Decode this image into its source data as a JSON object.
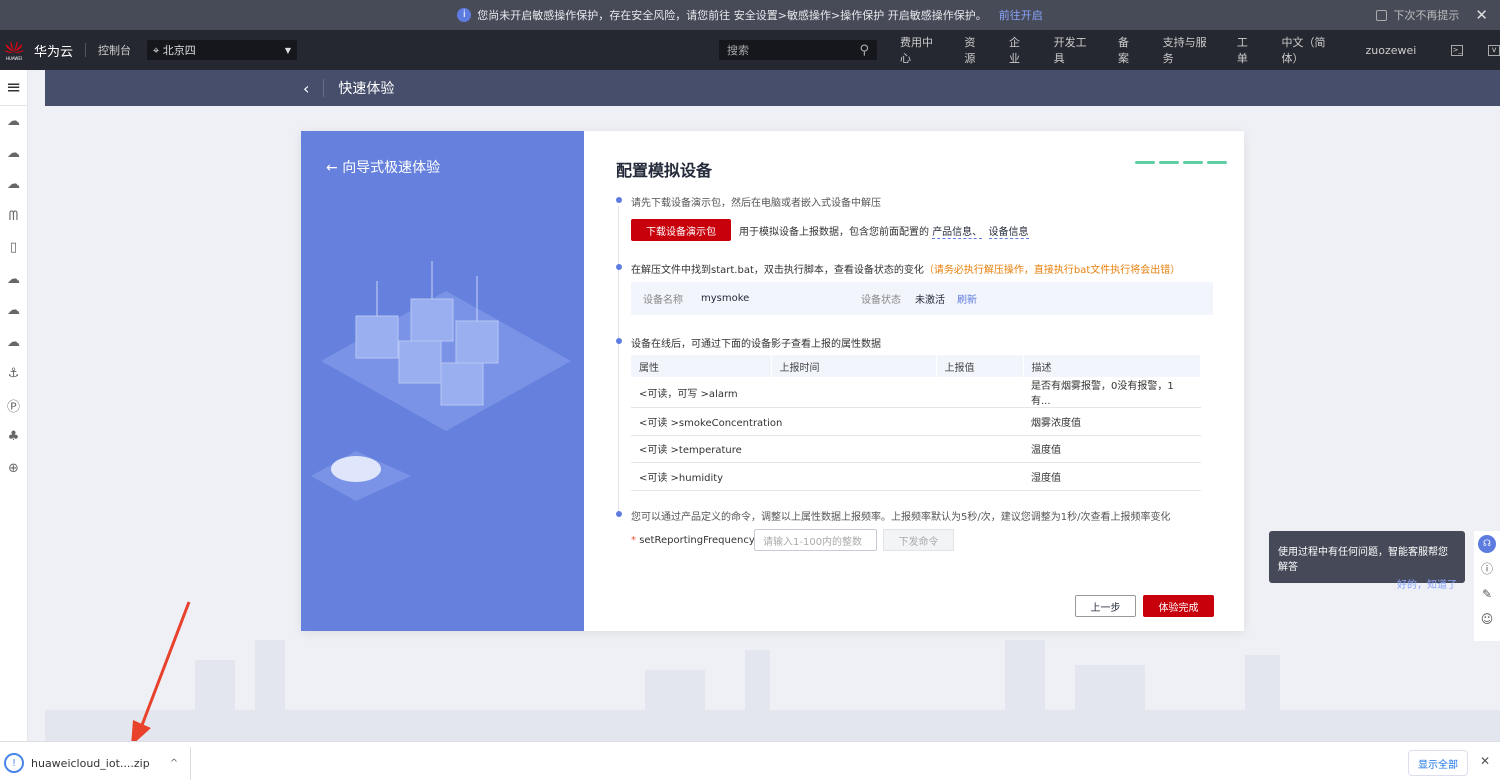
{
  "banner": {
    "message": "您尚未开启敏感操作保护，存在安全风险，请您前往 安全设置>敏感操作>操作保护 开启敏感操作保护。",
    "link": "前往开启",
    "dont_show": "下次不再提示"
  },
  "nav": {
    "logo_text": "HUAWEI",
    "brand": "华为云",
    "console": "控制台",
    "region": "北京四",
    "search_placeholder": "搜索",
    "items": [
      "费用中心",
      "资源",
      "企业",
      "开发工具",
      "备案",
      "支持与服务",
      "工单",
      "中文（简体）",
      "zuozewei"
    ]
  },
  "subheader": {
    "title": "快速体验"
  },
  "left_panel": {
    "title": "向导式极速体验"
  },
  "main": {
    "title": "配置模拟设备",
    "steps_total": 4,
    "steps_completed": 4,
    "accent": "#5cd0a1",
    "step1": {
      "text": "请先下载设备演示包，然后在电脑或者嵌入式设备中解压",
      "button": "下载设备演示包",
      "desc": "用于模拟设备上报数据，包含您前面配置的",
      "link1": "产品信息、",
      "link2": "设备信息"
    },
    "step2": {
      "text": "在解压文件中找到start.bat，双击执行脚本，查看设备状态的变化",
      "warning": "（请务必执行解压操作，直接执行bat文件执行将会出错）",
      "device_name_label": "设备名称",
      "device_name": "mysmoke",
      "device_status_label": "设备状态",
      "device_status": "未激活",
      "refresh": "刷新"
    },
    "step3": {
      "text": "设备在线后，可通过下面的设备影子查看上报的属性数据",
      "columns": [
        "属性",
        "上报时间",
        "上报值",
        "描述"
      ],
      "rows": [
        [
          "<可读，可写 >alarm",
          "",
          "",
          "是否有烟雾报警，0没有报警，1有..."
        ],
        [
          "<可读 >smokeConcentration",
          "",
          "",
          "烟雾浓度值"
        ],
        [
          "<可读 >temperature",
          "",
          "",
          "温度值"
        ],
        [
          "<可读 >humidity",
          "",
          "",
          "湿度值"
        ]
      ]
    },
    "step4": {
      "text": "您可以通过产品定义的命令，调整以上属性数据上报频率。上报频率默认为5秒/次，建议您调整为1秒/次查看上报频率变化",
      "required": "*",
      "param": "setReportingFrequency",
      "placeholder": "请输入1-100内的整数",
      "send": "下发命令"
    },
    "prev": "上一步",
    "finish": "体验完成"
  },
  "tooltip": {
    "text": "使用过程中有任何问题，智能客服帮您解答",
    "ok": "好的，知道了"
  },
  "download_bar": {
    "file": "huaweicloud_iot....zip",
    "show_all": "显示全部"
  }
}
